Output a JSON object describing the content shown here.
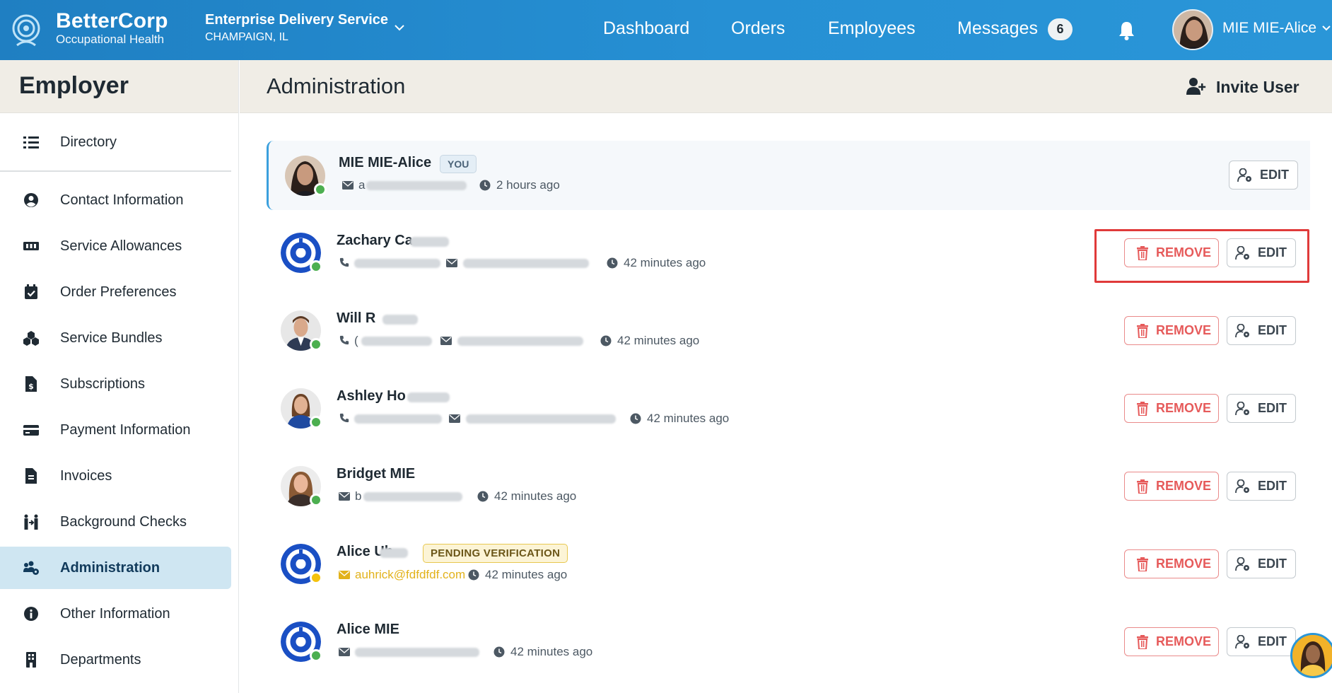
{
  "header": {
    "brand_name": "BetterCorp",
    "brand_sub": "Occupational Health",
    "company_name": "Enterprise Delivery Service",
    "company_location": "CHAMPAIGN, IL",
    "nav": [
      "Dashboard",
      "Orders",
      "Employees",
      "Messages"
    ],
    "messages_count": "6",
    "user_name": "MIE MIE-Alice"
  },
  "sidebar": {
    "title": "Employer",
    "items": [
      {
        "label": "Directory",
        "icon": "list-icon"
      },
      {
        "label": "Contact Information",
        "icon": "user-circle-icon"
      },
      {
        "label": "Service Allowances",
        "icon": "ticket-icon"
      },
      {
        "label": "Order Preferences",
        "icon": "calendar-check-icon"
      },
      {
        "label": "Service Bundles",
        "icon": "cubes-icon"
      },
      {
        "label": "Subscriptions",
        "icon": "file-invoice-dollar-icon"
      },
      {
        "label": "Payment Information",
        "icon": "credit-card-icon"
      },
      {
        "label": "Invoices",
        "icon": "file-icon"
      },
      {
        "label": "Background Checks",
        "icon": "people-arrows-icon"
      },
      {
        "label": "Administration",
        "icon": "users-cog-icon",
        "active": true
      },
      {
        "label": "Other Information",
        "icon": "info-circle-icon"
      },
      {
        "label": "Departments",
        "icon": "building-icon"
      }
    ]
  },
  "main": {
    "title": "Administration",
    "invite_label": "Invite User"
  },
  "users": [
    {
      "name": "MIE MIE-Alice",
      "badge": "YOU",
      "email_prefix": "a",
      "time": "2 hours ago",
      "status": "online"
    },
    {
      "name": "Zachary Ca",
      "phone_prefix": "",
      "time": "42 minutes ago",
      "status": "online"
    },
    {
      "name": "Will R",
      "phone_prefix": "(",
      "time": "42 minutes ago",
      "status": "online"
    },
    {
      "name": "Ashley Ho",
      "phone_prefix": "",
      "time": "42 minutes ago",
      "status": "online"
    },
    {
      "name": "Bridget MIE",
      "email_prefix": "b",
      "time": "42 minutes ago",
      "status": "online"
    },
    {
      "name": "Alice Uh",
      "badge": "PENDING VERIFICATION",
      "email": "auhrick@fdfdfdf.com",
      "time": "42 minutes ago",
      "status": "pending"
    },
    {
      "name": "Alice MIE",
      "time": "42 minutes ago",
      "status": "online"
    }
  ],
  "buttons": {
    "remove_label": "REMOVE",
    "edit_label": "EDIT"
  },
  "colors": {
    "header_blue": "#2690d4",
    "active_nav_bg": "#cfe6f2",
    "remove_red": "#e65a5a",
    "status_green": "#4caf50",
    "status_pending": "#f4c20d"
  }
}
